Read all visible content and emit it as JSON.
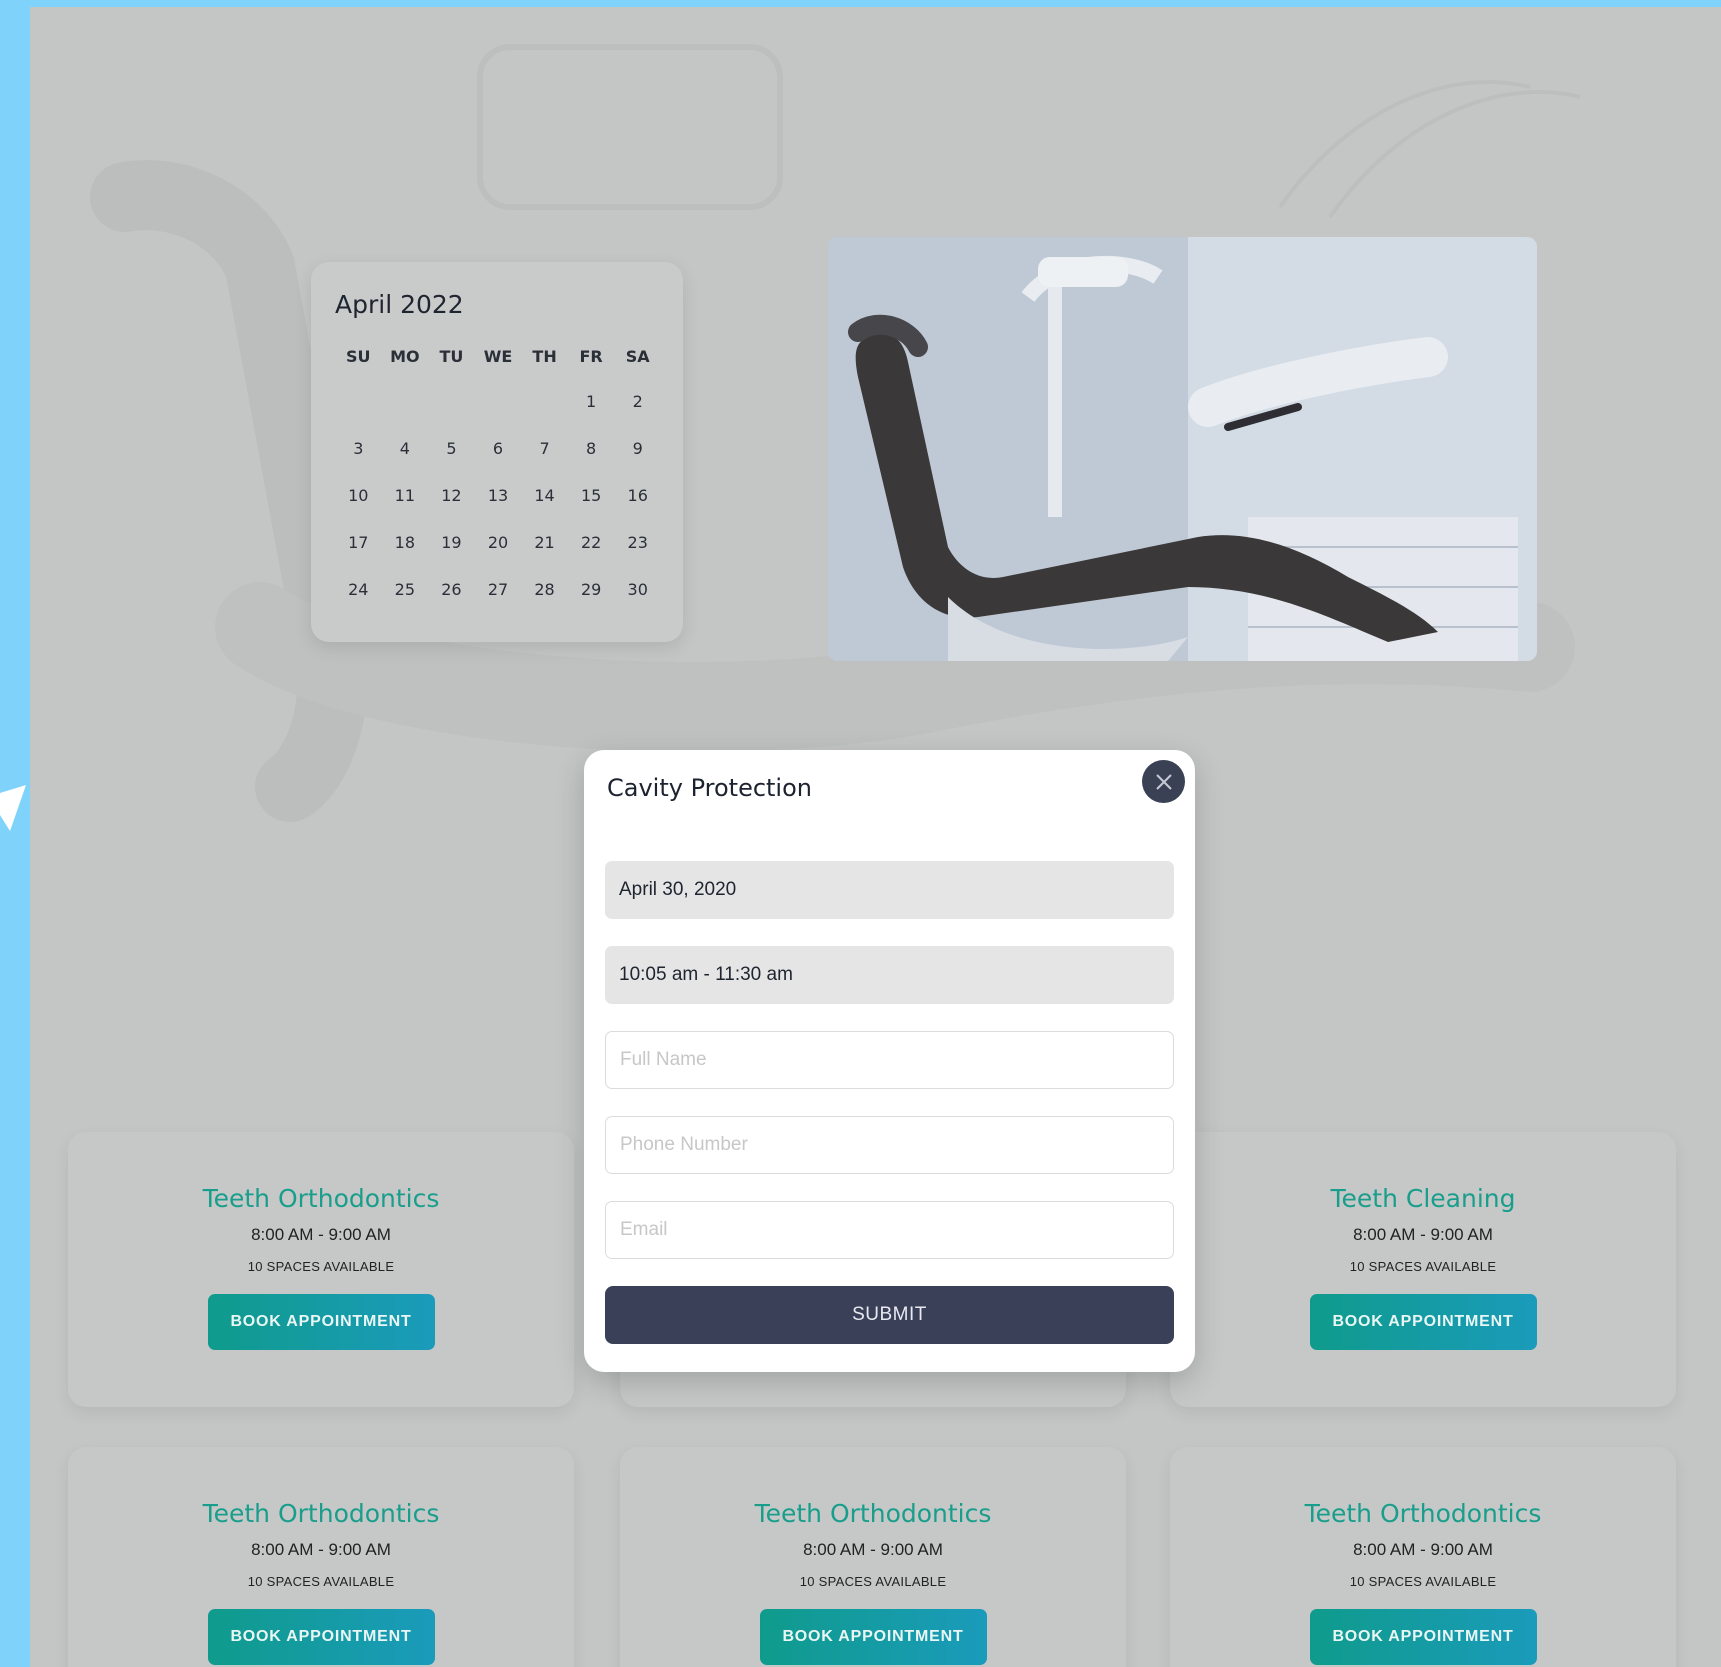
{
  "calendar": {
    "title": "April 2022",
    "weekdays": [
      "SU",
      "MO",
      "TU",
      "WE",
      "TH",
      "FR",
      "SA"
    ],
    "days": [
      "",
      "",
      "",
      "",
      "",
      "1",
      "2",
      "3",
      "4",
      "5",
      "6",
      "7",
      "8",
      "9",
      "10",
      "11",
      "12",
      "13",
      "14",
      "15",
      "16",
      "17",
      "18",
      "19",
      "20",
      "21",
      "22",
      "23",
      "24",
      "25",
      "26",
      "27",
      "28",
      "29",
      "30"
    ]
  },
  "cards": [
    {
      "title": "Teeth Orthodontics",
      "time": "8:00 AM - 9:00 AM",
      "spaces": "10 SPACES AVAILABLE",
      "button": "BOOK APPOINTMENT"
    },
    {
      "title": "Teeth Cleaning",
      "time": "8:00 AM - 9:00 AM",
      "spaces": "10 SPACES AVAILABLE",
      "button": "BOOK APPOINTMENT"
    },
    {
      "title": "Teeth Orthodontics",
      "time": "8:00 AM - 9:00 AM",
      "spaces": "10 SPACES AVAILABLE",
      "button": "BOOK APPOINTMENT"
    },
    {
      "title": "Teeth Orthodontics",
      "time": "8:00 AM - 9:00 AM",
      "spaces": "10 SPACES AVAILABLE",
      "button": "BOOK APPOINTMENT"
    },
    {
      "title": "Teeth Orthodontics",
      "time": "8:00 AM - 9:00 AM",
      "spaces": "10 SPACES AVAILABLE",
      "button": "BOOK APPOINTMENT"
    }
  ],
  "modal": {
    "title": "Cavity Protection",
    "date_value": "April 30, 2020",
    "time_value": "10:05 am - 11:30 am",
    "name_placeholder": "Full Name",
    "phone_placeholder": "Phone Number",
    "email_placeholder": "Email",
    "submit_label": "SUBMIT",
    "close_icon": "close-icon"
  },
  "colors": {
    "accent_teal": "#1a9e8c",
    "button_dark": "#3a4057",
    "frame_border": "#7fd3fb",
    "overlay_gray": "#c4c6c6"
  }
}
